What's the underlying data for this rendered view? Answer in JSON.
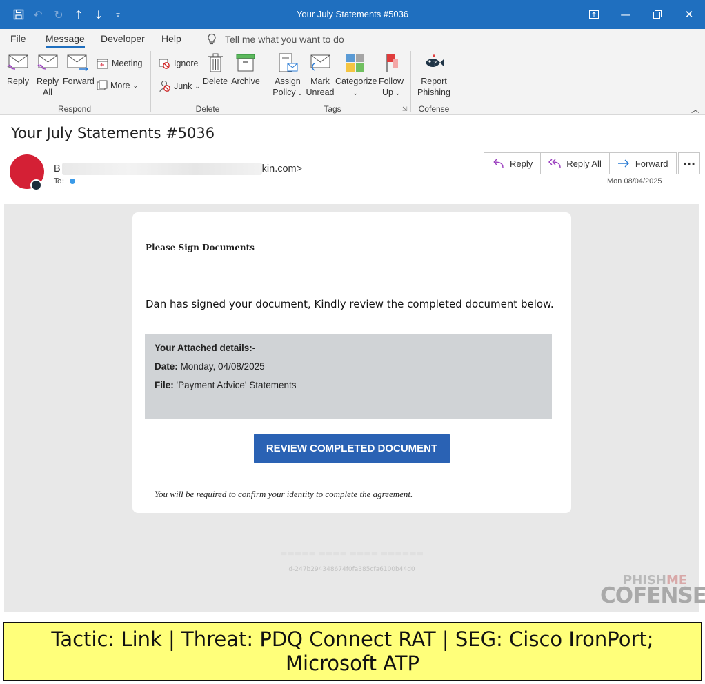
{
  "window": {
    "title": "Your July Statements #5036"
  },
  "tabs": [
    {
      "label": "File"
    },
    {
      "label": "Message"
    },
    {
      "label": "Developer"
    },
    {
      "label": "Help"
    }
  ],
  "tellme": {
    "text": "Tell me what you want to do"
  },
  "ribbon": {
    "reply": "Reply",
    "reply_all_1": "Reply",
    "reply_all_2": "All",
    "forward": "Forward",
    "meeting": "Meeting",
    "more": "More",
    "respond_group": "Respond",
    "ignore": "Ignore",
    "junk": "Junk",
    "delete": "Delete",
    "archive": "Archive",
    "delete_group": "Delete",
    "assign_1": "Assign",
    "assign_2": "Policy",
    "mark_1": "Mark",
    "mark_2": "Unread",
    "categorize": "Categorize",
    "follow_1": "Follow",
    "follow_2": "Up",
    "tags_group": "Tags",
    "report_1": "Report",
    "report_2": "Phishing",
    "cofense_group": "Cofense"
  },
  "message": {
    "subject": "Your July Statements #5036",
    "sender_initial": "B",
    "sender_suffix": "kin.com>",
    "to_label": "To:",
    "date": "Mon 08/04/2025",
    "actions": {
      "reply": "Reply",
      "reply_all": "Reply All",
      "forward": "Forward"
    }
  },
  "body": {
    "heading": "Please Sign Documents",
    "message": "Dan has signed your document, Kindly review the completed document below.",
    "details_title": "Your Attached details:-",
    "date_label": "Date:",
    "date_value": "Monday, 04/08/2025",
    "file_label": "File:",
    "file_value": "'Payment Advice' Statements",
    "cta": "REVIEW COMPLETED DOCUMENT",
    "note": "You will be required to confirm your identity to complete the agreement.",
    "footer_id": "d-247b294348674f0fa385cfa6100b44d0"
  },
  "watermark": {
    "top_a": "PHISH",
    "top_b": "ME",
    "main": "COFENSE"
  },
  "banner": {
    "text": "Tactic: Link | Threat: PDQ Connect RAT | SEG: Cisco IronPort; Microsoft ATP"
  }
}
